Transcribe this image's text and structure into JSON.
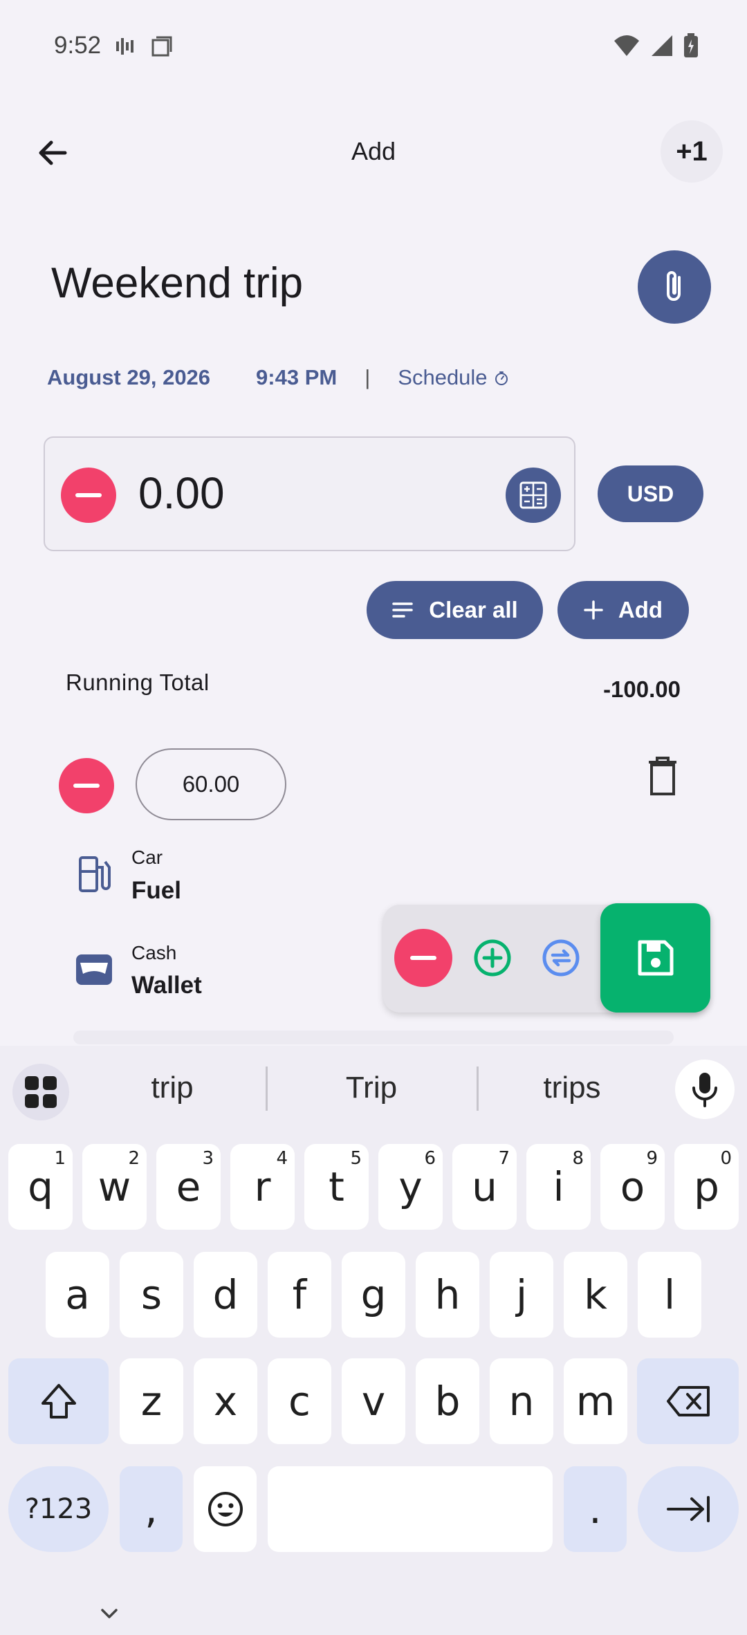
{
  "status_bar": {
    "time": "9:52"
  },
  "app_bar": {
    "title": "Add",
    "counter_label": "+1"
  },
  "transaction": {
    "title": "Weekend trip",
    "date": "August 29, 2026",
    "time": "9:43 PM",
    "separator": "|",
    "schedule_label": "Schedule",
    "amount": "0.00",
    "currency": "USD"
  },
  "actions": {
    "clear_all_label": "Clear all",
    "add_label": "Add"
  },
  "running_total": {
    "label": "Running Total",
    "value": "-100.00"
  },
  "split_item": {
    "amount": "60.00",
    "category_group": "Car",
    "category": "Fuel",
    "account_group": "Cash",
    "account": "Wallet"
  },
  "colors": {
    "primary": "#4a5c92",
    "expense_red": "#f2416b",
    "income_green": "#06b26e",
    "transfer_blue": "#5b8def"
  },
  "keyboard": {
    "suggestions": [
      "trip",
      "Trip",
      "trips"
    ],
    "row1": [
      {
        "k": "q",
        "h": "1"
      },
      {
        "k": "w",
        "h": "2"
      },
      {
        "k": "e",
        "h": "3"
      },
      {
        "k": "r",
        "h": "4"
      },
      {
        "k": "t",
        "h": "5"
      },
      {
        "k": "y",
        "h": "6"
      },
      {
        "k": "u",
        "h": "7"
      },
      {
        "k": "i",
        "h": "8"
      },
      {
        "k": "o",
        "h": "9"
      },
      {
        "k": "p",
        "h": "0"
      }
    ],
    "row2": [
      "a",
      "s",
      "d",
      "f",
      "g",
      "h",
      "j",
      "k",
      "l"
    ],
    "row3": [
      "z",
      "x",
      "c",
      "v",
      "b",
      "n",
      "m"
    ],
    "symbols_label": "?123",
    "comma_label": ",",
    "period_label": "."
  }
}
